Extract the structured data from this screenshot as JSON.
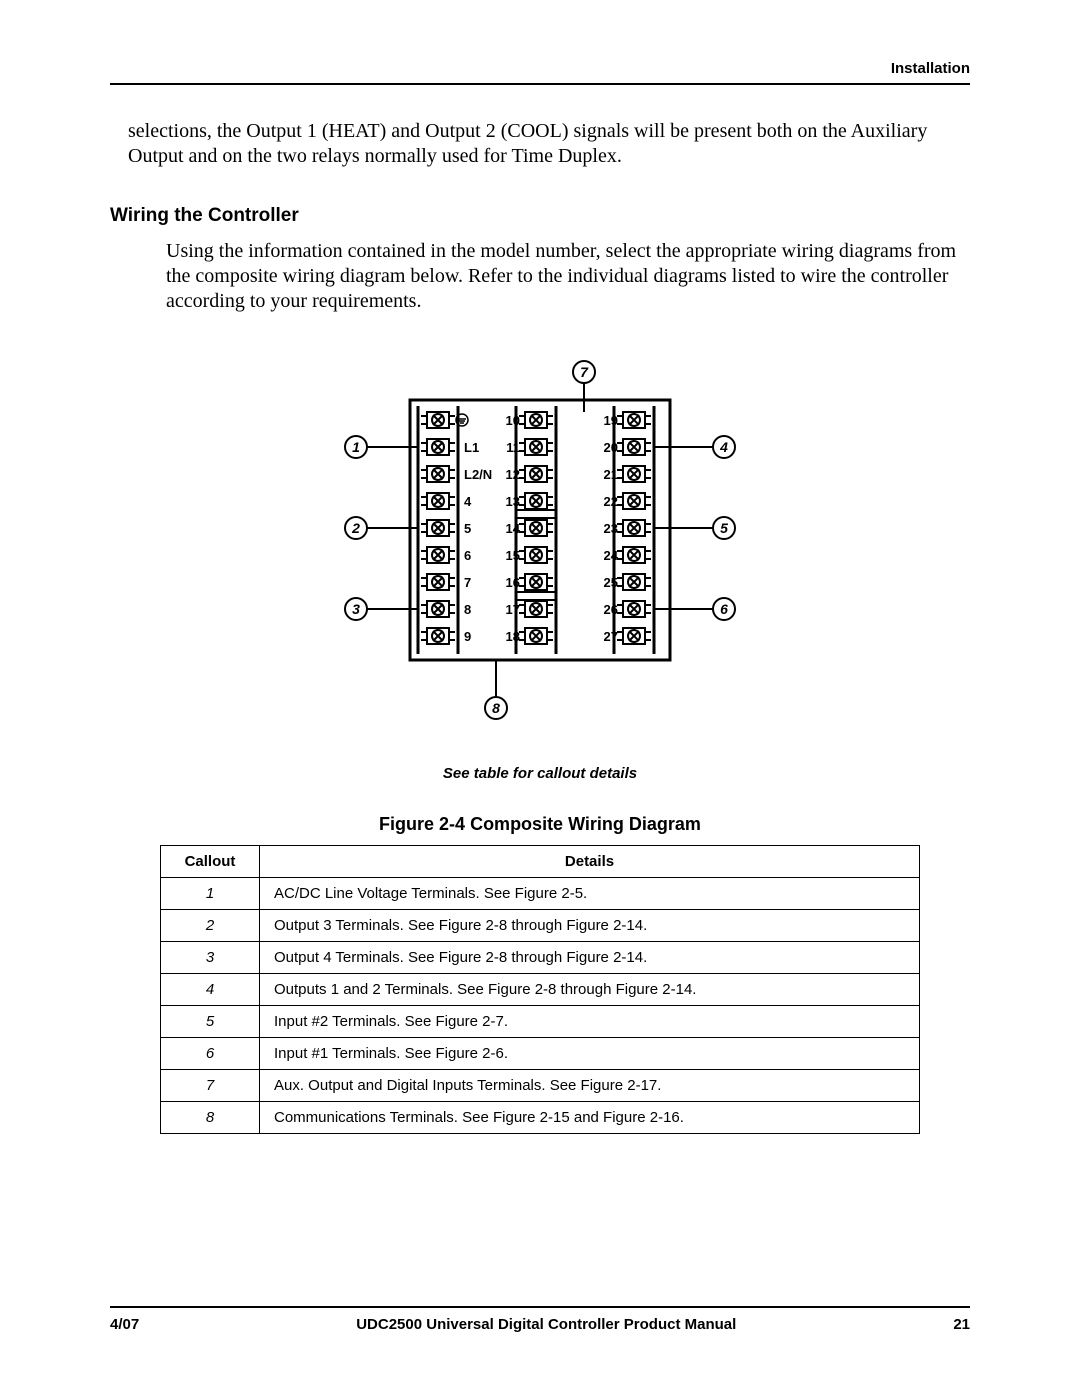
{
  "header": {
    "section": "Installation"
  },
  "paragraphs": {
    "intro": "selections, the Output 1 (HEAT) and Output 2 (COOL) signals will be present both on the Auxiliary Output and on the two relays normally used for Time Duplex.",
    "wiring_heading": "Wiring the Controller",
    "wiring_body": "Using the information contained in the model number, select the appropriate wiring diagrams from the composite wiring diagram below. Refer to the individual diagrams listed to wire the controller according to your requirements."
  },
  "diagram": {
    "note": "See table for callout details",
    "figure_title": "Figure 2-4  Composite Wiring Diagram",
    "left_labels": [
      "",
      "L1",
      "L2/N",
      "4",
      "5",
      "6",
      "7",
      "8",
      "9"
    ],
    "mid_labels": [
      "10",
      "11",
      "12",
      "13",
      "14",
      "15",
      "16",
      "17",
      "18"
    ],
    "right_labels": [
      "19",
      "20",
      "21",
      "22",
      "23",
      "24",
      "25",
      "26",
      "27"
    ],
    "callouts": [
      "1",
      "2",
      "3",
      "4",
      "5",
      "6",
      "7",
      "8"
    ]
  },
  "table": {
    "col_callout": "Callout",
    "col_details": "Details",
    "rows": [
      {
        "c": "1",
        "d": "AC/DC Line Voltage Terminals. See Figure 2-5."
      },
      {
        "c": "2",
        "d": "Output 3 Terminals. See Figure 2-8 through Figure 2-14."
      },
      {
        "c": "3",
        "d": "Output 4 Terminals. See Figure 2-8 through Figure 2-14."
      },
      {
        "c": "4",
        "d": "Outputs 1 and 2 Terminals. See Figure 2-8 through Figure 2-14."
      },
      {
        "c": "5",
        "d": "Input #2 Terminals. See Figure 2-7."
      },
      {
        "c": "6",
        "d": "Input #1 Terminals. See Figure 2-6."
      },
      {
        "c": "7",
        "d": "Aux. Output and Digital Inputs Terminals. See Figure 2-17."
      },
      {
        "c": "8",
        "d": "Communications Terminals. See Figure 2-15 and Figure 2-16."
      }
    ]
  },
  "footer": {
    "left": "4/07",
    "center": "UDC2500 Universal Digital Controller Product Manual",
    "right": "21"
  }
}
